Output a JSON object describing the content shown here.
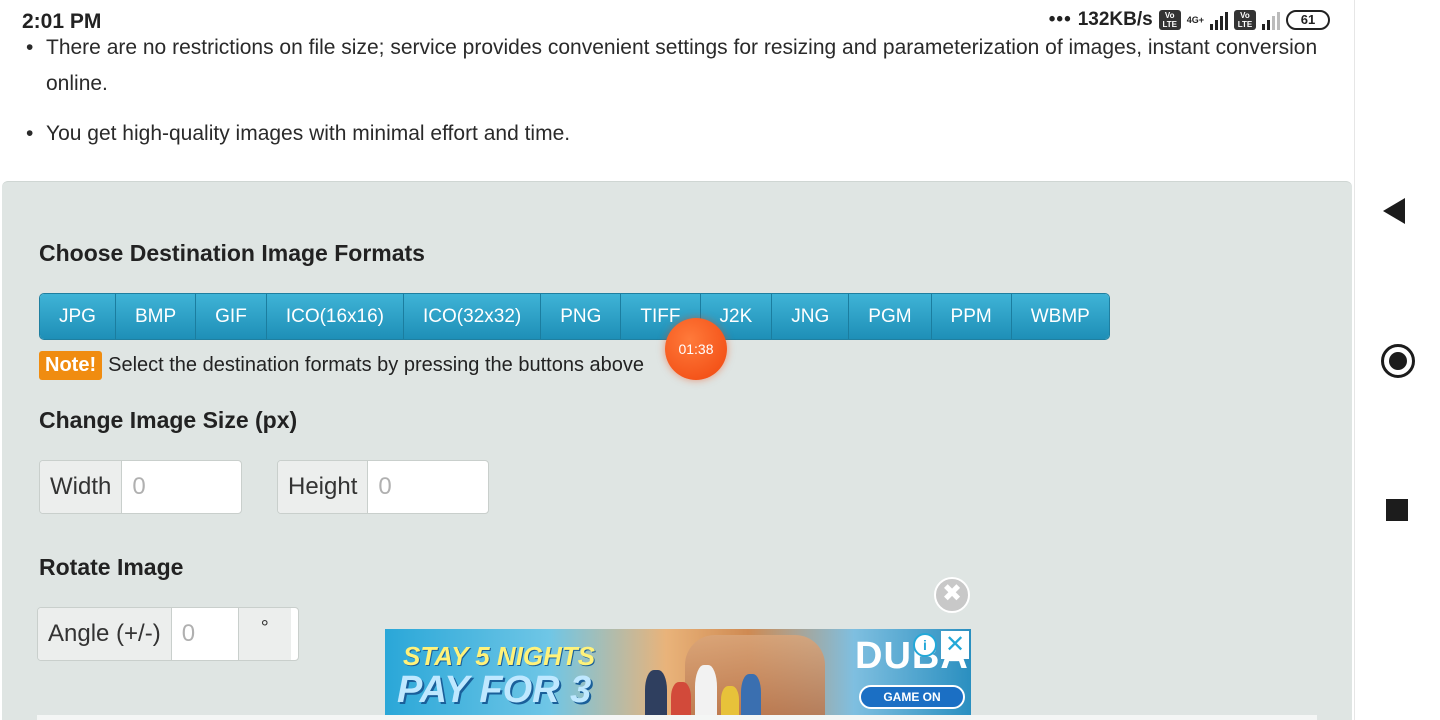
{
  "status_bar": {
    "time": "2:01 PM",
    "dots": "•••",
    "network_speed": "132KB/s",
    "volte1": "Vo LTE",
    "network_type": "4G+",
    "volte2": "Vo LTE",
    "battery": "61",
    "icons": [
      "volte-icon",
      "signal-icon",
      "volte-icon",
      "signal-icon",
      "battery-icon"
    ]
  },
  "content": {
    "bullets": [
      "There are no restrictions on file size; service provides convenient settings for resizing and parameterization of images, instant conversion online.",
      "You get high-quality images with minimal effort and time."
    ]
  },
  "formats_section": {
    "title": "Choose Destination Image Formats",
    "buttons": [
      "JPG",
      "BMP",
      "GIF",
      "ICO(16x16)",
      "ICO(32x32)",
      "PNG",
      "TIFF",
      "J2K",
      "JNG",
      "PGM",
      "PPM",
      "WBMP"
    ],
    "note_label": "Note!",
    "note_text": "Select the destination formats by pressing the buttons above"
  },
  "size_section": {
    "title": "Change Image Size (px)",
    "width_label": "Width",
    "width_placeholder": "0",
    "height_label": "Height",
    "height_placeholder": "0"
  },
  "rotate_section": {
    "title": "Rotate Image",
    "angle_label": "Angle (+/-)",
    "angle_placeholder": "0",
    "unit": "°"
  },
  "recording": {
    "timer": "01:38"
  },
  "ad": {
    "line1": "STAY 5 NIGHTS",
    "line2": "PAY FOR 3",
    "brand": "DUBAI",
    "cta": "GAME ON",
    "info": "i",
    "close": "✕",
    "outer_close": "✖"
  },
  "colors": {
    "button_gradient_top": "#3fb3d6",
    "button_gradient_bottom": "#1e8fb7",
    "note_badge": "#f08c10",
    "panel_bg": "#dfe5e3",
    "record_badge": "#f0460e"
  }
}
